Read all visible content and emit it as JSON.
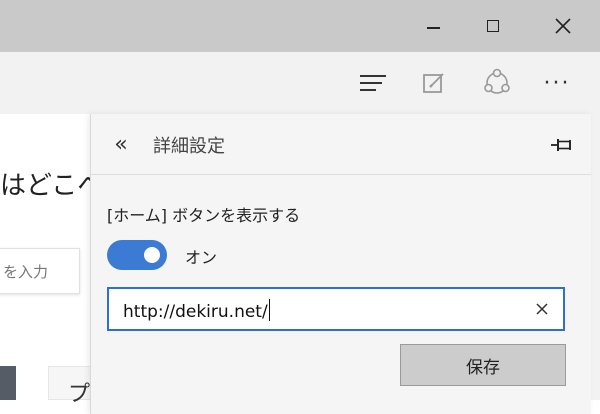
{
  "window": {
    "minimize_icon": "minimize-icon",
    "maximize_icon": "maximize-icon",
    "close_icon": "close-icon"
  },
  "toolbar": {
    "icons": [
      "hub-icon",
      "web-note-icon",
      "share-icon",
      "more-icon"
    ],
    "more_label": "···"
  },
  "page": {
    "heading_fragment": "はどこへ",
    "search_placeholder_fragment": "を入力",
    "tile_char": "プ"
  },
  "panel": {
    "back_label": "«",
    "title": "詳細設定",
    "setting_label": "[ホーム] ボタンを表示する",
    "toggle_state": "オン",
    "toggle_on": true,
    "url_value": "http://dekiru.net/",
    "clear_label": "×",
    "save_label": "保存"
  },
  "colors": {
    "accent": "#2f6fd1",
    "toggle": "#3b7bd3",
    "titlebar": "#c9c9c9",
    "panel_bg": "#f5f5f5"
  }
}
